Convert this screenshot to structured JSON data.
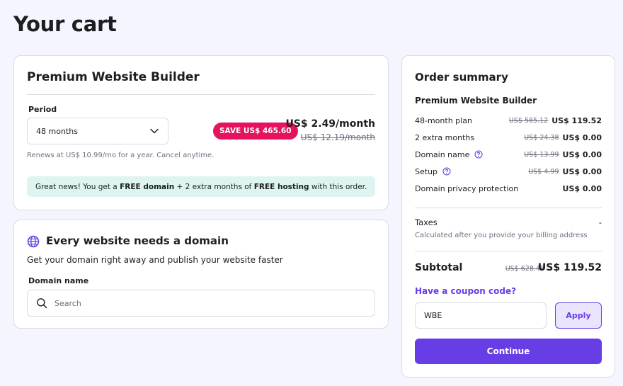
{
  "page_title": "Your cart",
  "colors": {
    "accent": "#673de6",
    "save_badge": "#e4125f",
    "promo_bg": "#def4f0"
  },
  "plan": {
    "title": "Premium Website Builder",
    "period_label": "Period",
    "period_value": "48 months",
    "save_badge": "SAVE US$ 465.60",
    "price": "US$ 2.49/month",
    "old_price": "US$ 12.19/month",
    "renew_note": "Renews at US$ 10.99/mo for a year. Cancel anytime.",
    "promo": {
      "part1": "Great news! You get a ",
      "bold1": "FREE domain",
      "part2": " + 2 extra months of ",
      "bold2": "FREE hosting",
      "part3": " with this order."
    }
  },
  "domain": {
    "title": "Every website needs a domain",
    "subtitle": "Get your domain right away and publish your website faster",
    "label": "Domain name",
    "placeholder": "Search"
  },
  "summary": {
    "title": "Order summary",
    "product": "Premium Website Builder",
    "lines": [
      {
        "label": "48-month plan",
        "old": "US$ 585.12",
        "value": "US$ 119.52"
      },
      {
        "label": "2 extra months",
        "old": "US$ 24.38",
        "value": "US$ 0.00"
      },
      {
        "label": "Domain name",
        "old": "US$ 13.99",
        "value": "US$ 0.00"
      },
      {
        "label": "Setup",
        "old": "US$ 4.99",
        "value": "US$ 0.00"
      },
      {
        "label": "Domain privacy protection",
        "old": "",
        "value": "US$ 0.00"
      }
    ],
    "taxes_label": "Taxes",
    "taxes_value": "-",
    "taxes_note": "Calculated after you provide your billing address",
    "subtotal_label": "Subtotal",
    "subtotal_old": "US$ 628.48",
    "subtotal_value": "US$ 119.52",
    "coupon_link": "Have a coupon code?",
    "coupon_value": "WBE",
    "apply_label": "Apply",
    "continue_label": "Continue"
  }
}
